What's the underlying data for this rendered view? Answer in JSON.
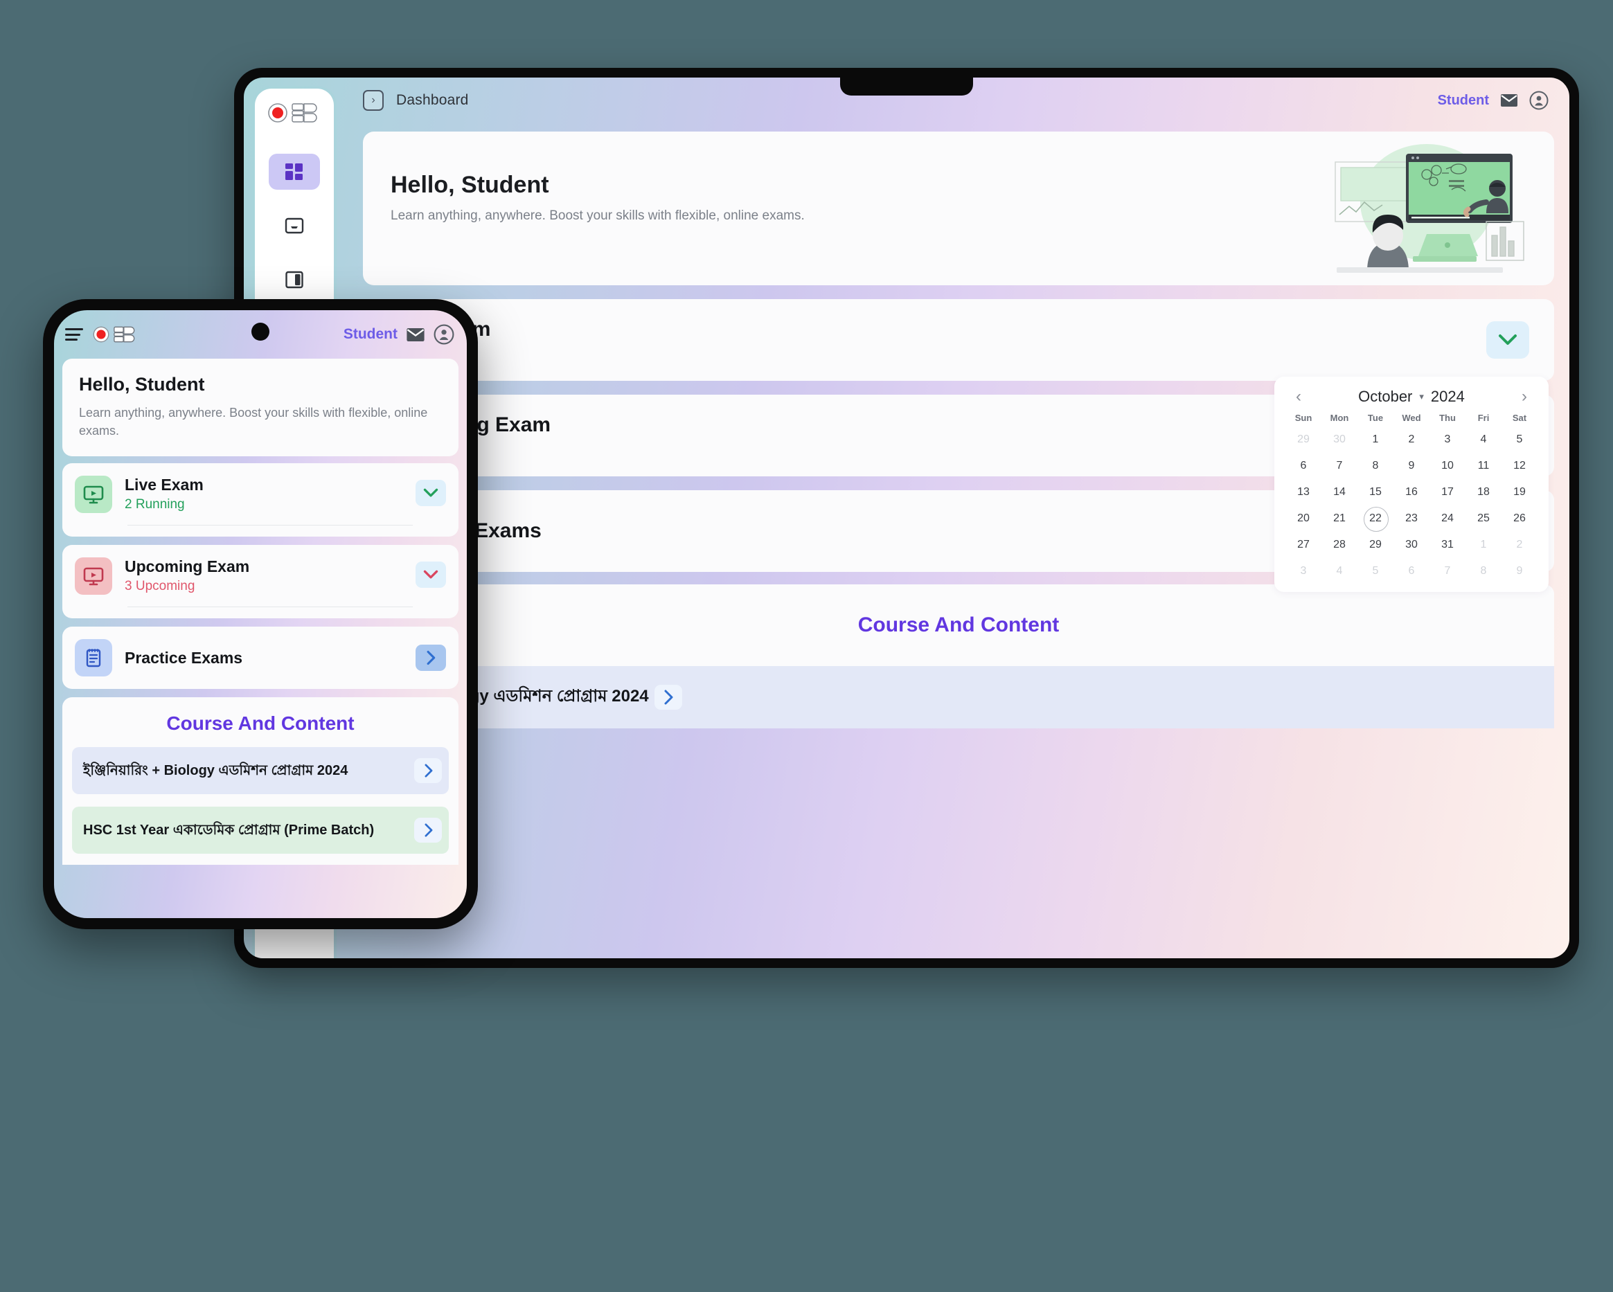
{
  "brand": {
    "name": "OEB",
    "accent": "#6137e0",
    "user_accent": "#6d5ce7"
  },
  "tablet": {
    "topbar": {
      "expand_icon": "chevron-right-boxed-icon",
      "title": "Dashboard",
      "user_label": "Student",
      "mail_icon": "mail-icon",
      "avatar_icon": "account-circle-icon"
    },
    "sidebar": {
      "items": [
        {
          "name": "dashboard",
          "icon": "grid-dashboard-icon",
          "active": true
        },
        {
          "name": "inbox",
          "icon": "inbox-tray-icon",
          "active": false
        },
        {
          "name": "library",
          "icon": "book-layout-icon",
          "active": false
        },
        {
          "name": "help",
          "icon": "question-circle-icon",
          "active": false
        }
      ]
    },
    "hero": {
      "greeting": "Hello, Student",
      "subtitle": "Learn anything, anywhere. Boost your skills with flexible, online exams.",
      "illustration": "online-learning-illustration"
    },
    "rows": [
      {
        "title": "Live Exam",
        "sub": "2 Running",
        "sub_color": "#23a05b",
        "button_icon": "chevron-down-icon",
        "button_color": "#23a05b"
      },
      {
        "title": "Upcoming Exam",
        "sub": "3 Upcoming",
        "sub_color": "#e0566b",
        "button_icon": "chevron-down-icon",
        "button_color": "#e0566b"
      },
      {
        "title": "Practice Exams",
        "sub": "",
        "sub_color": "",
        "button_icon": "chevron-right-icon",
        "button_color": "#2f6fd0"
      }
    ],
    "course_section": {
      "title": "Course And Content",
      "items": [
        {
          "label": "রিং + Biology এডমিশন প্রোগ্রাম 2024",
          "chip_icon": "chevron-right-icon"
        }
      ]
    },
    "calendar": {
      "prev_icon": "chevron-left-icon",
      "next_icon": "chevron-right-icon",
      "month": "October",
      "month_caret_icon": "chevron-down-icon",
      "year": "2024",
      "dow": [
        "Sun",
        "Mon",
        "Tue",
        "Wed",
        "Thu",
        "Fri",
        "Sat"
      ],
      "selected_day": 22,
      "weeks": [
        [
          {
            "d": "29",
            "m": true
          },
          {
            "d": "30",
            "m": true
          },
          {
            "d": "1",
            "m": false
          },
          {
            "d": "2",
            "m": false
          },
          {
            "d": "3",
            "m": false
          },
          {
            "d": "4",
            "m": false
          },
          {
            "d": "5",
            "m": false
          }
        ],
        [
          {
            "d": "6",
            "m": false
          },
          {
            "d": "7",
            "m": false
          },
          {
            "d": "8",
            "m": false
          },
          {
            "d": "9",
            "m": false
          },
          {
            "d": "10",
            "m": false
          },
          {
            "d": "11",
            "m": false
          },
          {
            "d": "12",
            "m": false
          }
        ],
        [
          {
            "d": "13",
            "m": false
          },
          {
            "d": "14",
            "m": false
          },
          {
            "d": "15",
            "m": false
          },
          {
            "d": "16",
            "m": false
          },
          {
            "d": "17",
            "m": false
          },
          {
            "d": "18",
            "m": false
          },
          {
            "d": "19",
            "m": false
          }
        ],
        [
          {
            "d": "20",
            "m": false
          },
          {
            "d": "21",
            "m": false
          },
          {
            "d": "22",
            "m": false,
            "today": true
          },
          {
            "d": "23",
            "m": false
          },
          {
            "d": "24",
            "m": false
          },
          {
            "d": "25",
            "m": false
          },
          {
            "d": "26",
            "m": false
          }
        ],
        [
          {
            "d": "27",
            "m": false
          },
          {
            "d": "28",
            "m": false
          },
          {
            "d": "29",
            "m": false
          },
          {
            "d": "30",
            "m": false
          },
          {
            "d": "31",
            "m": false
          },
          {
            "d": "1",
            "m": true
          },
          {
            "d": "2",
            "m": true
          }
        ],
        [
          {
            "d": "3",
            "m": true
          },
          {
            "d": "4",
            "m": true
          },
          {
            "d": "5",
            "m": true
          },
          {
            "d": "6",
            "m": true
          },
          {
            "d": "7",
            "m": true
          },
          {
            "d": "8",
            "m": true
          },
          {
            "d": "9",
            "m": true
          }
        ]
      ]
    }
  },
  "phone": {
    "topbar": {
      "menu_icon": "hamburger-menu-icon",
      "logo": "OEB",
      "user_label": "Student",
      "mail_icon": "mail-icon",
      "avatar_icon": "account-circle-icon"
    },
    "hero": {
      "greeting": "Hello, Student",
      "subtitle": "Learn anything, anywhere. Boost your skills with flexible, online exams."
    },
    "rows": [
      {
        "title": "Live Exam",
        "sub": "2 Running",
        "icon": "live-exam-screen-icon",
        "button_icon": "chevron-down-icon"
      },
      {
        "title": "Upcoming Exam",
        "sub": "3 Upcoming",
        "icon": "upcoming-exam-screen-icon",
        "button_icon": "chevron-down-icon"
      },
      {
        "title": "Practice Exams",
        "sub": "",
        "icon": "clipboard-notes-icon",
        "button_icon": "chevron-right-icon"
      }
    ],
    "course_section": {
      "title": "Course And Content",
      "items": [
        {
          "label": "ইঞ্জিনিয়ারিং + Biology এডমিশন প্রোগ্রাম 2024",
          "chip_icon": "chevron-right-icon"
        },
        {
          "label": "HSC 1st Year একাডেমিক প্রোগ্রাম (Prime Batch)",
          "chip_icon": "chevron-right-icon"
        }
      ]
    }
  }
}
